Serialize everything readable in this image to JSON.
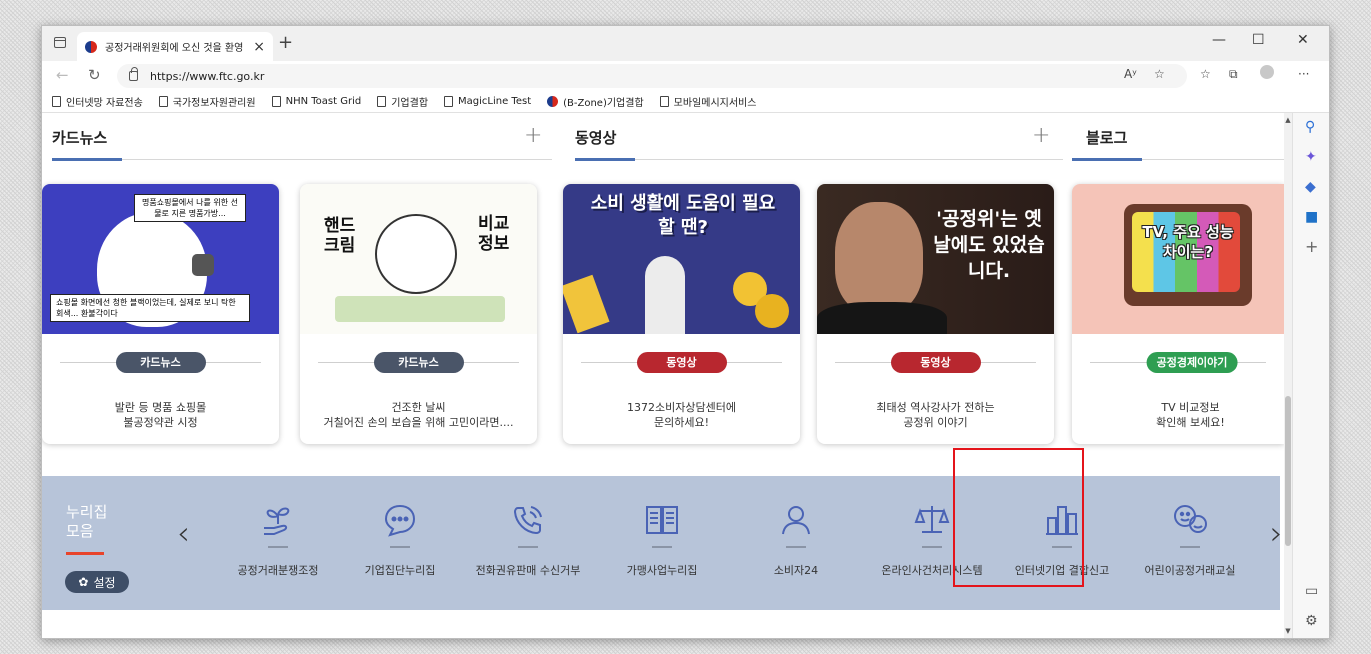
{
  "browser": {
    "tab_title": "공정거래위원회에 오신 것을 환영",
    "tab_close": "×",
    "new_tab": "+",
    "url": "https://www.ftc.go.kr",
    "minimize": "—",
    "maximize": "☐",
    "close": "✕",
    "read_aloud": "Aʸ",
    "bookmarks": [
      "인터넷망 자료전송",
      "국가정보자원관리원",
      "NHN Toast Grid",
      "기업결합",
      "MagicLine Test",
      "(B-Zone)기업결합",
      "모바일메시지서비스"
    ]
  },
  "sections": {
    "card_news": "카드뉴스",
    "video": "동영상",
    "blog": "블로그",
    "plus": "+"
  },
  "cards": [
    {
      "badge": "카드뉴스",
      "badge_color": "#4a5568",
      "line1": "발란 등 명품 쇼핑몰",
      "line2": "불공정약관 시정",
      "thumb_top": "명품쇼핑몰에서 나를 위한 선물로 지른 명품가방...",
      "thumb_bottom": "쇼핑몰 화면에선 청한 블랙이었는데, 실제로 보니 탁한 회색... 환불각이다"
    },
    {
      "badge": "카드뉴스",
      "badge_color": "#4a5568",
      "line1": "건조한 날씨",
      "line2": "거칠어진 손의 보습을 위해 고민이라면....",
      "thumb_left": "핸드 크림",
      "thumb_right": "비교 정보"
    },
    {
      "badge": "동영상",
      "badge_color": "#b8272f",
      "line1": "1372소비자상담센터에",
      "line2": "문의하세요!",
      "thumb_title": "소비 생활에 도움이 필요할 땐?"
    },
    {
      "badge": "동영상",
      "badge_color": "#b8272f",
      "line1": "최태성 역사강사가 전하는",
      "line2": "공정위 이야기",
      "thumb_title": "'공정위'는 옛날에도 있었습니다."
    },
    {
      "badge": "공정경제이야기",
      "badge_color": "#2e9e52",
      "line1": "TV 비교정보",
      "line2": "확인해 보세요!",
      "thumb_title": "TV, 주요 성능 차이는?"
    }
  ],
  "nuri": {
    "title_line1": "누리집",
    "title_line2": "모음",
    "settings": "설정",
    "prev": "‹",
    "next": "›",
    "items": [
      {
        "label": "공정거래분쟁조정",
        "icon": "plant-hand-icon"
      },
      {
        "label": "기업집단누리집",
        "icon": "chat-bubble-icon"
      },
      {
        "label": "전화권유판매 수신거부",
        "icon": "phone-icon"
      },
      {
        "label": "가맹사업누리집",
        "icon": "book-icon"
      },
      {
        "label": "소비자24",
        "icon": "person-icon"
      },
      {
        "label": "온라인사건처리시스템",
        "icon": "scale-icon"
      },
      {
        "label": "인터넷기업 결합신고",
        "icon": "building-chart-icon"
      },
      {
        "label": "어린이공정거래교실",
        "icon": "kids-face-icon"
      }
    ]
  },
  "colors": {
    "accent_blue": "#4a6fb2",
    "nuri_bg": "#b7c4d9",
    "highlight_red": "#e4141b"
  }
}
